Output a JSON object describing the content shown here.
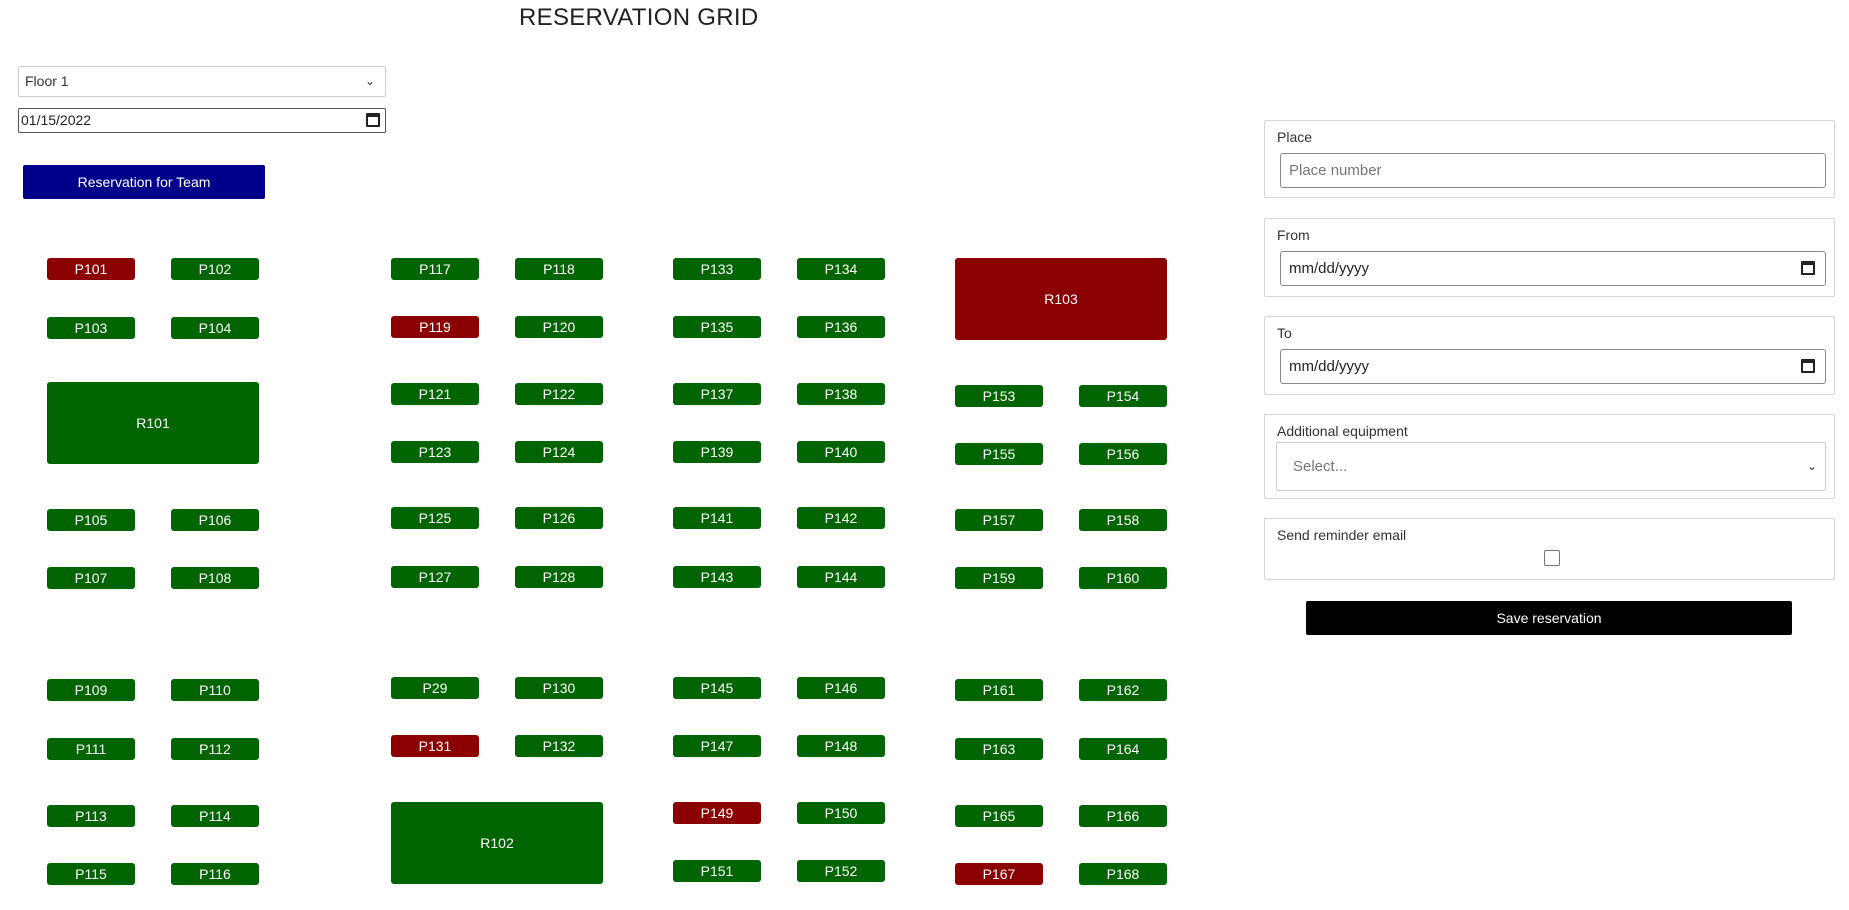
{
  "page_title": "RESERVATION GRID",
  "floor_select": {
    "value": "Floor 1"
  },
  "date_filter": {
    "value": "01/15/2022"
  },
  "team_button_label": "Reservation for Team",
  "colors": {
    "free": "#006400",
    "taken": "#8b0000",
    "team_button": "#00008b",
    "save_button": "#000000"
  },
  "places": [
    {
      "id": "P101",
      "status": "taken"
    },
    {
      "id": "P102",
      "status": "free"
    },
    {
      "id": "P103",
      "status": "free"
    },
    {
      "id": "P104",
      "status": "free"
    },
    {
      "id": "P105",
      "status": "free"
    },
    {
      "id": "P106",
      "status": "free"
    },
    {
      "id": "P107",
      "status": "free"
    },
    {
      "id": "P108",
      "status": "free"
    },
    {
      "id": "P109",
      "status": "free"
    },
    {
      "id": "P110",
      "status": "free"
    },
    {
      "id": "P111",
      "status": "free"
    },
    {
      "id": "P112",
      "status": "free"
    },
    {
      "id": "P113",
      "status": "free"
    },
    {
      "id": "P114",
      "status": "free"
    },
    {
      "id": "P115",
      "status": "free"
    },
    {
      "id": "P116",
      "status": "free"
    },
    {
      "id": "P117",
      "status": "free"
    },
    {
      "id": "P118",
      "status": "free"
    },
    {
      "id": "P119",
      "status": "taken"
    },
    {
      "id": "P120",
      "status": "free"
    },
    {
      "id": "P121",
      "status": "free"
    },
    {
      "id": "P122",
      "status": "free"
    },
    {
      "id": "P123",
      "status": "free"
    },
    {
      "id": "P124",
      "status": "free"
    },
    {
      "id": "P125",
      "status": "free"
    },
    {
      "id": "P126",
      "status": "free"
    },
    {
      "id": "P127",
      "status": "free"
    },
    {
      "id": "P128",
      "status": "free"
    },
    {
      "id": "P29",
      "status": "free"
    },
    {
      "id": "P130",
      "status": "free"
    },
    {
      "id": "P131",
      "status": "taken"
    },
    {
      "id": "P132",
      "status": "free"
    },
    {
      "id": "P133",
      "status": "free"
    },
    {
      "id": "P134",
      "status": "free"
    },
    {
      "id": "P135",
      "status": "free"
    },
    {
      "id": "P136",
      "status": "free"
    },
    {
      "id": "P137",
      "status": "free"
    },
    {
      "id": "P138",
      "status": "free"
    },
    {
      "id": "P139",
      "status": "free"
    },
    {
      "id": "P140",
      "status": "free"
    },
    {
      "id": "P141",
      "status": "free"
    },
    {
      "id": "P142",
      "status": "free"
    },
    {
      "id": "P143",
      "status": "free"
    },
    {
      "id": "P144",
      "status": "free"
    },
    {
      "id": "P145",
      "status": "free"
    },
    {
      "id": "P146",
      "status": "free"
    },
    {
      "id": "P147",
      "status": "free"
    },
    {
      "id": "P148",
      "status": "free"
    },
    {
      "id": "P149",
      "status": "taken"
    },
    {
      "id": "P150",
      "status": "free"
    },
    {
      "id": "P151",
      "status": "free"
    },
    {
      "id": "P152",
      "status": "free"
    },
    {
      "id": "P153",
      "status": "free"
    },
    {
      "id": "P154",
      "status": "free"
    },
    {
      "id": "P155",
      "status": "free"
    },
    {
      "id": "P156",
      "status": "free"
    },
    {
      "id": "P157",
      "status": "free"
    },
    {
      "id": "P158",
      "status": "free"
    },
    {
      "id": "P159",
      "status": "free"
    },
    {
      "id": "P160",
      "status": "free"
    },
    {
      "id": "P161",
      "status": "free"
    },
    {
      "id": "P162",
      "status": "free"
    },
    {
      "id": "P163",
      "status": "free"
    },
    {
      "id": "P164",
      "status": "free"
    },
    {
      "id": "P165",
      "status": "free"
    },
    {
      "id": "P166",
      "status": "free"
    },
    {
      "id": "P167",
      "status": "taken"
    },
    {
      "id": "P168",
      "status": "free"
    }
  ],
  "rooms": [
    {
      "id": "R101",
      "status": "free"
    },
    {
      "id": "R102",
      "status": "free"
    },
    {
      "id": "R103",
      "status": "taken"
    }
  ],
  "form": {
    "place": {
      "label": "Place",
      "placeholder": "Place number"
    },
    "from": {
      "label": "From",
      "placeholder": "mm/dd/yyyy"
    },
    "to": {
      "label": "To",
      "placeholder": "mm/dd/yyyy"
    },
    "equipment": {
      "label": "Additional equipment",
      "placeholder": "Select..."
    },
    "reminder": {
      "label": "Send reminder email",
      "checked": false
    },
    "save_label": "Save reservation"
  }
}
